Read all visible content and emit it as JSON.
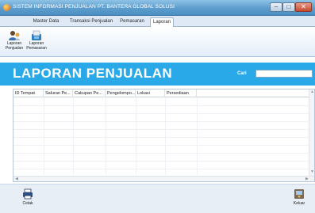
{
  "window": {
    "title": "SISTEM INFORMASI PENJUALAN PT. BANTERA GLOBAL SOLUSI",
    "icon": "app-icon",
    "controls": {
      "minimize": "–",
      "maximize": "□",
      "close": "✕"
    }
  },
  "menu": {
    "tabs": [
      {
        "label": "Master Data"
      },
      {
        "label": "Transaksi Penjualan"
      },
      {
        "label": "Pemasaran"
      },
      {
        "label": "Laporan",
        "active": true
      }
    ]
  },
  "ribbon": {
    "buttons": [
      {
        "label": "Laporan Penjualan",
        "icon": "sales-report-icon"
      },
      {
        "label": "Laporan Pemasaran",
        "icon": "marketing-report-icon"
      }
    ]
  },
  "page": {
    "title": "LAPORAN PENJUALAN",
    "search_label": "Cari",
    "search_value": ""
  },
  "table": {
    "columns": [
      "ID Tempat",
      "Saluran Pe...",
      "Cakupan Pe...",
      "Pengelompo...",
      "Lokasi",
      "Persediaan"
    ],
    "rows": []
  },
  "footer": {
    "print_label": "Cetak",
    "exit_label": "Keluar"
  },
  "colors": {
    "header_bg": "#2aa9e8",
    "titlebar": "#5d9dcc",
    "accent": "#ffffff"
  }
}
